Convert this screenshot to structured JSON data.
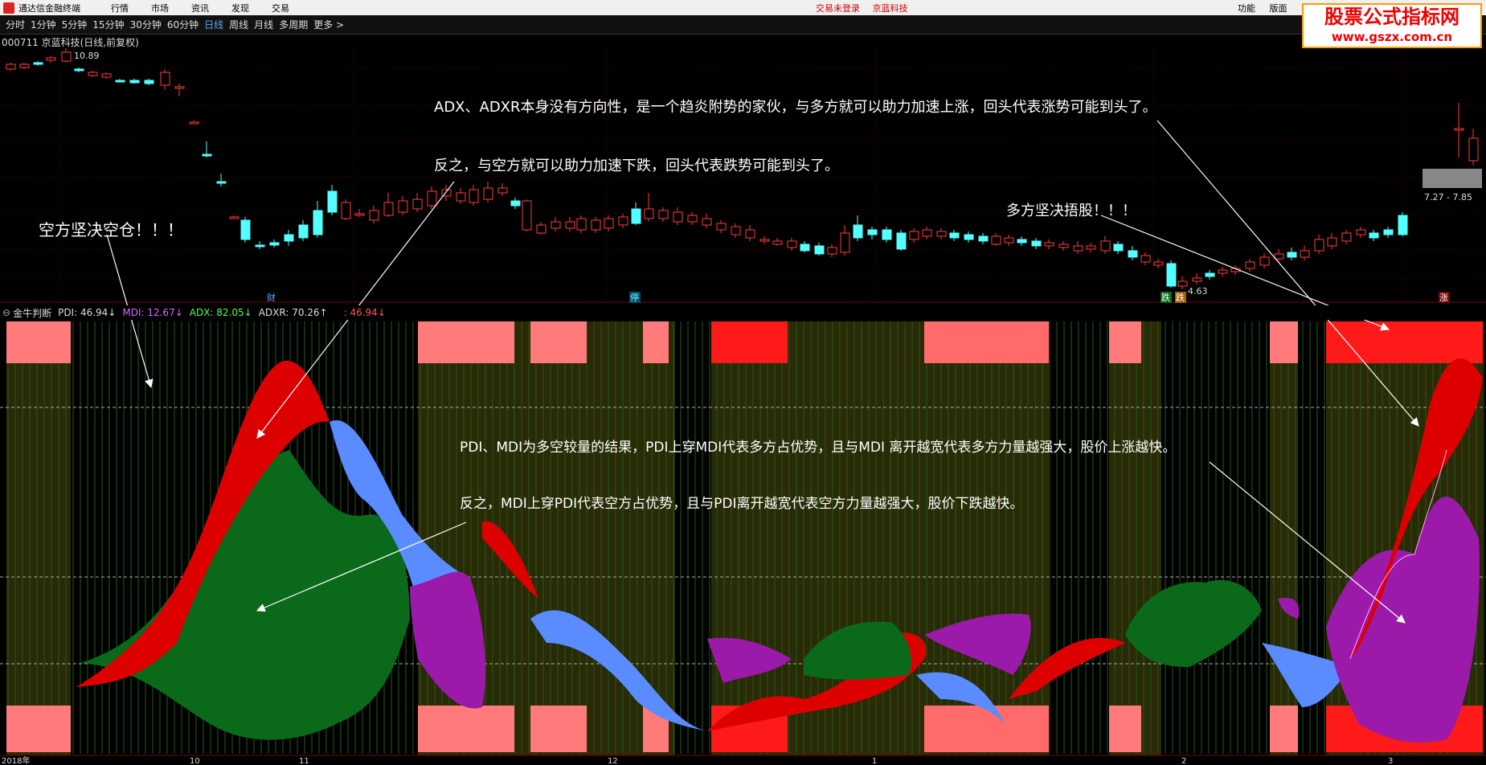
{
  "titlebar": {
    "app": "通达信金融终端",
    "menus": [
      "行情",
      "市场",
      "资讯",
      "发现",
      "交易"
    ],
    "status_login": "交易未登录",
    "stock_name": "京蓝科技",
    "right_items": [
      "功能",
      "版面"
    ]
  },
  "watermark": {
    "line1": "股票公式指标网",
    "line2": "www.gszx.com.cn"
  },
  "toolbar": [
    "分时",
    "1分钟",
    "5分钟",
    "15分钟",
    "30分钟",
    "60分钟",
    "日线",
    "周线",
    "月线",
    "多周期",
    "更多 >"
  ],
  "toolbar_active": "日线",
  "stock_info": "000711 京蓝科技(日线,前复权)",
  "price_labels": {
    "high": "10.89",
    "low": "4.63",
    "range": "7.27 - 7.85"
  },
  "event_labels": [
    "财",
    "停",
    "跌",
    "跌",
    "涨"
  ],
  "indicator": {
    "name": "金牛判断",
    "pdi": "PDI: 46.94↓",
    "mdi": "MDI: 12.67↓",
    "adx": "ADX: 82.05↓",
    "adxr": "ADXR: 70.26↑",
    "extra": ": 46.94↓"
  },
  "annotations": {
    "adx_1": "ADX、ADXR本身没有方向性，是一个趋炎附势的家伙，与多方就可以助力加速上涨，回头代表涨势可能到头了。",
    "adx_2": "反之，与空方就可以助力加速下跌，回头代表跌势可能到头了。",
    "bear": "空方坚决空仓！！！",
    "bull": "多方坚决捂股！！！",
    "pdi_1": "PDI、MDI为多空较量的结果，PDI上穿MDI代表多方占优势，且与MDI 离开越宽代表多方力量越强大，股价上涨越快。",
    "pdi_2": "反之，MDI上穿PDI代表空方占优势，且与PDI离开越宽代表空方力量越强大，股价下跌越快。"
  },
  "dates": [
    "2018年",
    "10",
    "11",
    "12",
    "1",
    "2",
    "3"
  ],
  "colors": {
    "up": "#ff3b3b",
    "down": "#54ffff",
    "pdi_fill": "#dd0000",
    "mdi_fill": "#5b8cff",
    "green_fill": "#0a6a1a",
    "purple_fill": "#9b1aaa"
  }
}
